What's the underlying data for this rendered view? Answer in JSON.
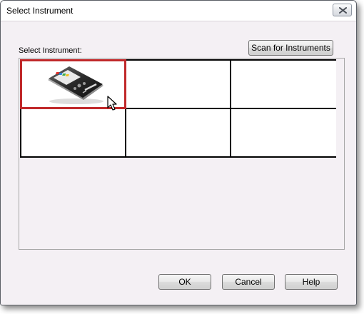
{
  "window": {
    "title": "Select Instrument"
  },
  "header": {
    "label": "Select Instrument:",
    "scan_button_label": "Scan for Instruments"
  },
  "grid": {
    "cells": [
      {
        "id": "cell-1",
        "selected": true,
        "icon": "colorimeter-device-icon"
      },
      {
        "id": "cell-2",
        "selected": false
      },
      {
        "id": "cell-3",
        "selected": false
      },
      {
        "id": "cell-4",
        "selected": false
      },
      {
        "id": "cell-5",
        "selected": false
      },
      {
        "id": "cell-6",
        "selected": false
      }
    ]
  },
  "footer": {
    "ok_label": "OK",
    "cancel_label": "Cancel",
    "help_label": "Help"
  },
  "colors": {
    "selection_border": "#c0282a",
    "dialog_background": "#f4f0f4"
  }
}
